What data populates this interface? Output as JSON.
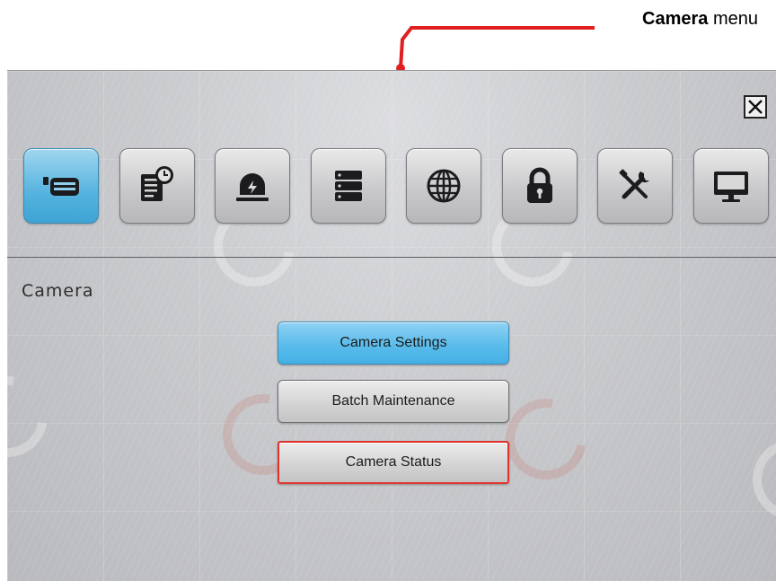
{
  "callout": {
    "bold": "Camera",
    "rest": " menu",
    "line_color": "#e02020"
  },
  "toolbar": {
    "icons": [
      {
        "name": "camera-icon",
        "active": true
      },
      {
        "name": "schedule-icon",
        "active": false
      },
      {
        "name": "alarm-icon",
        "active": false
      },
      {
        "name": "storage-icon",
        "active": false
      },
      {
        "name": "network-icon",
        "active": false
      },
      {
        "name": "lock-icon",
        "active": false
      },
      {
        "name": "tools-icon",
        "active": false
      },
      {
        "name": "display-icon",
        "active": false
      }
    ]
  },
  "section": {
    "title": "Camera"
  },
  "menu": {
    "camera_settings": "Camera Settings",
    "batch_maintenance": "Batch Maintenance",
    "camera_status": "Camera Status"
  },
  "colors": {
    "accent_blue": "#4fb4e4",
    "highlight_red": "#e0332e"
  }
}
